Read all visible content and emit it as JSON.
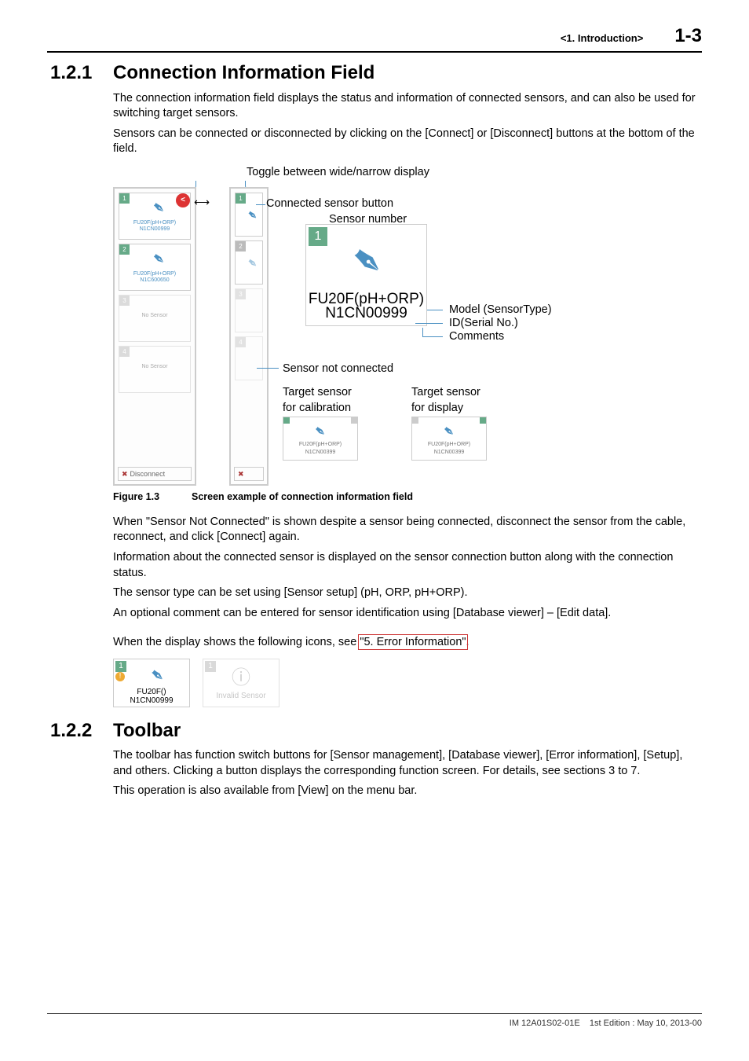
{
  "header": {
    "section": "<1.  Introduction>",
    "page": "1-3"
  },
  "sec1": {
    "num": "1.2.1",
    "title": "Connection Information Field",
    "p1": "The connection information field displays the status and information of connected sensors, and can also be used for switching target sensors.",
    "p2": "Sensors can be connected or disconnected by clicking on the [Connect] or [Disconnect] buttons at the bottom of the field."
  },
  "fig": {
    "ann_toggle": "Toggle between wide/narrow display",
    "ann_connected": "Connected sensor button",
    "ann_sensornum": "Sensor number",
    "ann_model": "Model (SensorType)",
    "ann_id": "ID(Serial No.)",
    "ann_comments": "Comments",
    "ann_notconn": "Sensor not connected",
    "ann_target_cal": "Target sensor\nfor calibration",
    "ann_target_disp": "Target sensor\nfor display",
    "big_model": "FU20F(pH+ORP)",
    "big_id": "N1CN00999",
    "chip1": "FU20F(pH+ORP)\nN1CN00999",
    "chip2": "FU20F(pH+ORP)\nN1C600650",
    "chip3": "No Sensor",
    "chip4": "No Sensor",
    "disconnect": "Disconnect",
    "tgt_label": "FU20F(pH+ORP)\nN1CN00399",
    "caption_label": "Figure 1.3",
    "caption_text": "Screen example of connection information field"
  },
  "post": {
    "p1": "When \"Sensor Not Connected\" is shown despite a sensor being connected, disconnect the sensor from the cable, reconnect, and click [Connect] again.",
    "p2": "Information about the connected sensor is displayed on the sensor connection button along with the connection status.",
    "p3": "The sensor type can be set using [Sensor setup] (pH, ORP, pH+ORP).",
    "p4": "An optional comment can be entered for sensor identification using [Database viewer] – [Edit data].",
    "p5_a": "When the display shows the following icons, see ",
    "p5_link": "\"5.  Error Information\"",
    "p5_b": ".",
    "card1_label": "FU20F()\nN1CN00999",
    "card2_label": "Invalid Sensor"
  },
  "sec2": {
    "num": "1.2.2",
    "title": "Toolbar",
    "p1": "The toolbar has function switch buttons for [Sensor management], [Database viewer], [Error information], [Setup], and others. Clicking a button displays the corresponding function screen. For details, see sections 3 to 7.",
    "p2": "This operation is also available from [View] on the menu bar."
  },
  "footer": {
    "im": "IM 12A01S02-01E",
    "ed": "1st Edition : May 10, 2013-00"
  }
}
